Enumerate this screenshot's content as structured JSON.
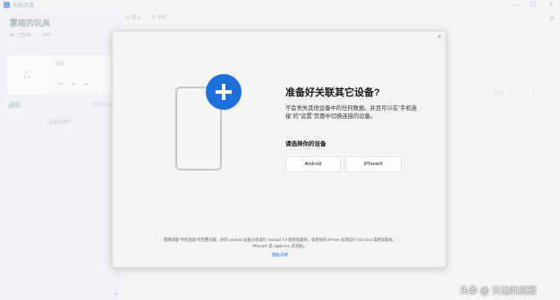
{
  "window": {
    "title": "手机连接",
    "controls": {
      "minimize": "—",
      "maximize": "☐",
      "close": "✕"
    }
  },
  "sidebar": {
    "phone_name": "雾雨的玩具",
    "status": {
      "connection": "已连接",
      "battery": "76%"
    },
    "music": {
      "label": "媒体"
    },
    "notifications": {
      "title": "通知",
      "clear": "全部清除",
      "empty": "没有新通知"
    }
  },
  "main": {
    "tabs": [
      {
        "icon": "◎",
        "label": "短信"
      },
      {
        "icon": "✆",
        "label": "呼叫"
      }
    ],
    "select_label": "选择",
    "more": "⋮"
  },
  "dialog": {
    "title": "准备好关联其它设备?",
    "description": "不会丢失其他设备中的任何数据。并且可以在\"手机连接\"的\"设置\"页面中切换连接的设备。",
    "choose_label": "请选择你的设备",
    "options": {
      "android": "Android",
      "iphone": "iPhone®"
    },
    "footer_line1": "需要获取\"手机连接\"的完整功能，你的 Android 设备必须运行 Android 7.0 或更高版本，或者你的 iPhone 必须运行 iOS 14.0 或更高版本。",
    "footer_line2": "iPhone® 是 Apple Inc. 的商标。",
    "privacy_link": "隐私声明",
    "close": "×"
  },
  "watermark": "头条 @ 天边的孤雁",
  "colors": {
    "accent": "#1e6fd9"
  }
}
